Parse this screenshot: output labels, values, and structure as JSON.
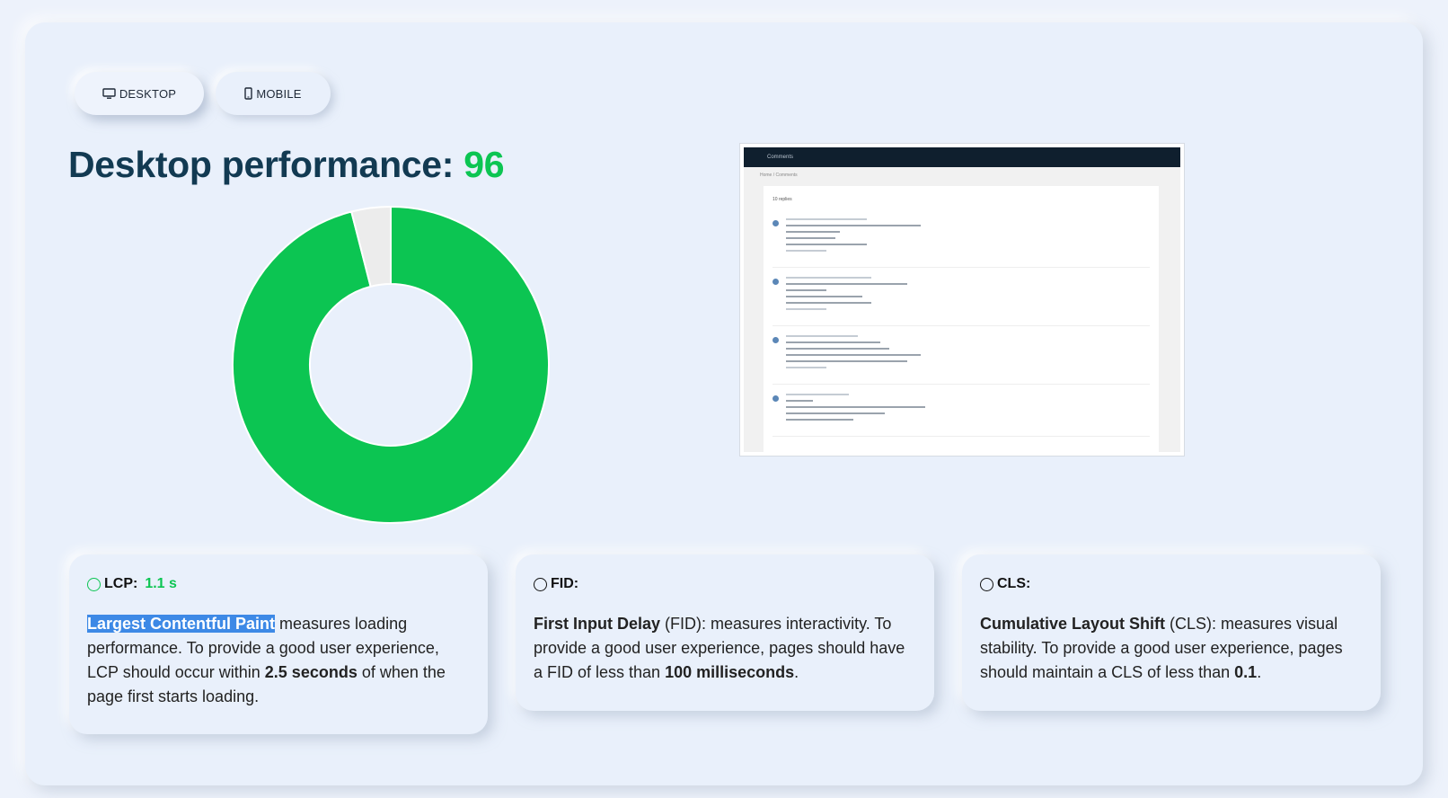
{
  "tabs": [
    {
      "label": "DESKTOP",
      "icon": "desktop-icon",
      "active": true
    },
    {
      "label": "MOBILE",
      "icon": "mobile-icon",
      "active": false
    }
  ],
  "performance": {
    "title_prefix": "Desktop performance: ",
    "score": "96"
  },
  "chart_data": {
    "type": "pie",
    "donut": true,
    "slices": [
      {
        "value": 96,
        "color": "#0cc552"
      },
      {
        "value": 4,
        "color": "#ececec"
      }
    ]
  },
  "preview": {
    "nav_title": "Comments",
    "breadcrumb": "Home / Comments",
    "replies_label": "10 replies"
  },
  "metrics": [
    {
      "label": "LCP:",
      "value": "1.1 s",
      "status_color": "#0cc552",
      "term": "Largest Contentful Paint",
      "text_a": " measures loading performance. To provide a good user experience, LCP should occur within ",
      "bold": "2.5 seconds",
      "text_b": " of when the page first starts loading."
    },
    {
      "label": "FID:",
      "value": "",
      "term": "First Input Delay",
      "text_a": " (FID): measures interactivity. To provide a good user experience, pages should have a FID of less than ",
      "bold": "100 milliseconds",
      "text_b": "."
    },
    {
      "label": "CLS:",
      "value": "",
      "term": "Cumulative Layout Shift",
      "text_a": " (CLS): measures visual stability. To provide a good user experience, pages should maintain a CLS of less than ",
      "bold": "0.1",
      "text_b": "."
    }
  ]
}
